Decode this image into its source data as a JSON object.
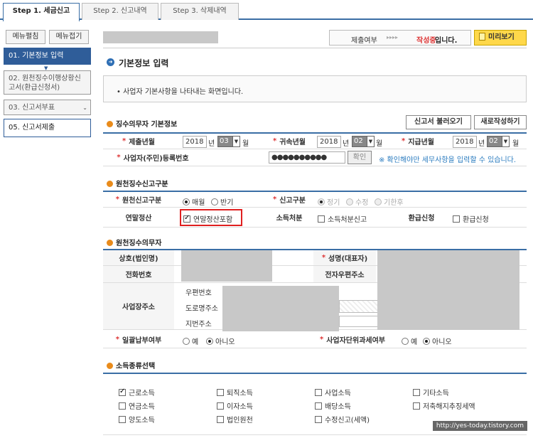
{
  "tabs": [
    {
      "label": "Step 1. 세금신고"
    },
    {
      "label": "Step 2. 신고내역"
    },
    {
      "label": "Step 3. 삭제내역"
    }
  ],
  "sidebar": {
    "expand_label": "메뉴펼침",
    "collapse_label": "메뉴접기",
    "items": [
      {
        "label": "01. 기본정보 입력"
      },
      {
        "label": "02. 원천징수이행상황신고서(환급신청서)"
      },
      {
        "label": "03. 신고서부표"
      },
      {
        "label": "05. 신고서제출"
      }
    ]
  },
  "header": {
    "submit_label": "제출여부",
    "arrows": "▸▸▸▸",
    "status": "작성중",
    "status_suffix": "입니다.",
    "preview_label": "미리보기"
  },
  "page_title": "기본정보 입력",
  "info_text": "사업자 기본사항을 나타내는 화면입니다.",
  "basic": {
    "title": "징수의무자 기본정보",
    "load_button": "신고서 불러오기",
    "new_button": "새로작성하기",
    "submit_ym_label": "제출년월",
    "year1": "2018",
    "month1": "03",
    "year_unit": "년",
    "month_unit": "월",
    "belong_ym_label": "귀속년월",
    "year2": "2018",
    "month2": "02",
    "pay_ym_label": "지급년월",
    "year3": "2018",
    "month3": "02",
    "regno_label": "사업자(주민)등록번호",
    "regno_value": "●●●●●●●●●●",
    "confirm_label": "확인",
    "hint": "※ 확인해야만 세무사항을 입력할 수 있습니다."
  },
  "withholding": {
    "title": "원천징수신고구분",
    "type_label": "원천신고구분",
    "monthly": "매월",
    "half": "반기",
    "report_label": "신고구분",
    "regular": "정기",
    "amend": "수정",
    "late": "기한후",
    "yearend_label": "연말정산",
    "yearend_cb": "연말정산포함",
    "income_label": "소득처분",
    "income_cb": "소득처분신고",
    "refund_label": "환급신청",
    "refund_cb": "환급신청"
  },
  "agent": {
    "title": "원천징수의무자",
    "company_label": "상호(법인명)",
    "ceo_label": "성명(대표자)",
    "phone_label": "전화번호",
    "email_label": "전자우편주소",
    "address_label": "사업장주소",
    "zip_label": "우편번호",
    "road_label": "도로명주소",
    "lot_label": "지번주소",
    "lump_label": "일괄납부여부",
    "unit_label": "사업자단위과세여부",
    "yes": "예",
    "no": "아니오"
  },
  "income_types": {
    "title": "소득종류선택",
    "items": [
      {
        "label": "근로소득",
        "checked": true
      },
      {
        "label": "퇴직소득",
        "checked": false
      },
      {
        "label": "사업소득",
        "checked": false
      },
      {
        "label": "기타소득",
        "checked": false
      },
      {
        "label": "연금소득",
        "checked": false
      },
      {
        "label": "이자소득",
        "checked": false
      },
      {
        "label": "배당소득",
        "checked": false
      },
      {
        "label": "저축해지추징세액",
        "checked": false
      },
      {
        "label": "양도소득",
        "checked": false
      },
      {
        "label": "법인원천",
        "checked": false
      },
      {
        "label": "수정신고(세액)",
        "checked": false
      }
    ]
  },
  "watermark": "http://yes-today.tistory.com",
  "colors": {
    "accent": "#2f5d99",
    "status": "#d33",
    "highlight": "#e02020"
  }
}
